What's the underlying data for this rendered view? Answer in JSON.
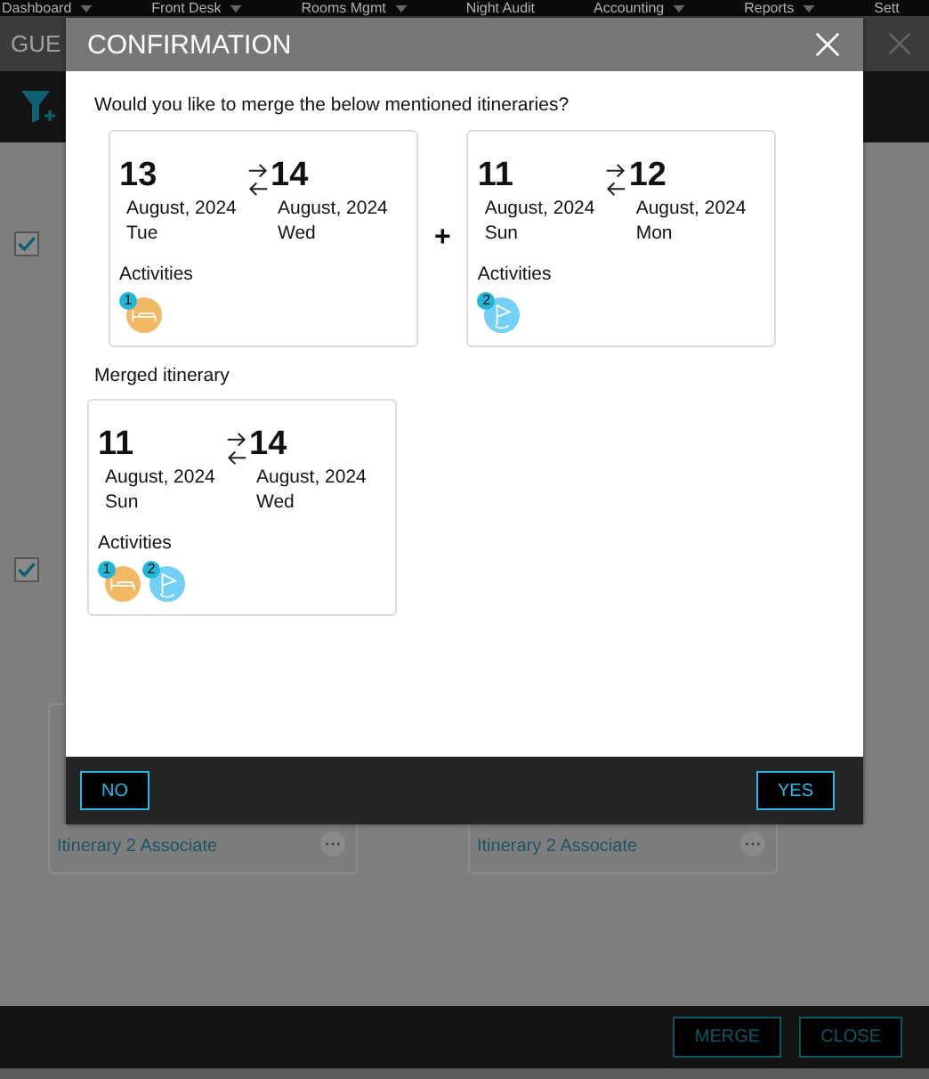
{
  "menu": [
    {
      "label": "Dashboard",
      "dropdown": true
    },
    {
      "label": "Front Desk",
      "dropdown": true
    },
    {
      "label": "Rooms Mgmt",
      "dropdown": true
    },
    {
      "label": "Night Audit",
      "dropdown": false
    },
    {
      "label": "Accounting",
      "dropdown": true
    },
    {
      "label": "Reports",
      "dropdown": true
    },
    {
      "label": "Sett",
      "dropdown": false
    }
  ],
  "window": {
    "title": "GUE"
  },
  "background": {
    "checkboxes": [
      {
        "checked": true
      },
      {
        "checked": true
      }
    ],
    "cards": [
      {
        "link": "Itinerary 2 Associate"
      },
      {
        "link": "Itinerary 2 Associate"
      }
    ],
    "buttons": [
      "MERGE",
      "CLOSE"
    ]
  },
  "dialog": {
    "title": "CONFIRMATION",
    "question": "Would you like to merge the below mentioned itineraries?",
    "itineraries": [
      {
        "from": {
          "day": "13",
          "month": "August, 2024",
          "weekday": "Tue"
        },
        "to": {
          "day": "14",
          "month": "August, 2024",
          "weekday": "Wed"
        },
        "activities_label": "Activities",
        "activities": [
          {
            "kind": "bed",
            "badge": "1"
          }
        ]
      },
      {
        "from": {
          "day": "11",
          "month": "August, 2024",
          "weekday": "Sun"
        },
        "to": {
          "day": "12",
          "month": "August, 2024",
          "weekday": "Mon"
        },
        "activities_label": "Activities",
        "activities": [
          {
            "kind": "flag",
            "badge": "2"
          }
        ]
      }
    ],
    "plus": "+",
    "merged_label": "Merged itinerary",
    "merged": {
      "from": {
        "day": "11",
        "month": "August, 2024",
        "weekday": "Sun"
      },
      "to": {
        "day": "14",
        "month": "August, 2024",
        "weekday": "Wed"
      },
      "activities_label": "Activities",
      "activities": [
        {
          "kind": "bed",
          "badge": "1"
        },
        {
          "kind": "flag",
          "badge": "2"
        }
      ]
    },
    "no": "NO",
    "yes": "YES"
  }
}
